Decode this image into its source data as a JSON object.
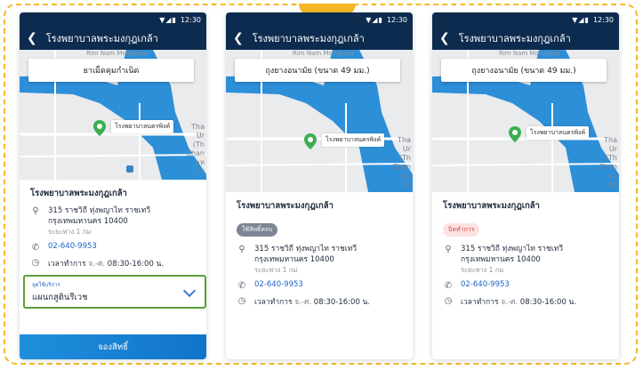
{
  "statusbar": {
    "time": "12:30",
    "icons": "▼◢▮"
  },
  "nav": {
    "title": "โรงพยาบาลพระมงกุฎเกล้า"
  },
  "map": {
    "street_label": "Rim Nam Mongkata",
    "poi_label": "โรงพยาบาลนครพิงค์",
    "side_text": [
      "Tha",
      "Ur",
      "(Th",
      "Chan",
      "มห",
      "ธร"
    ]
  },
  "phones": [
    {
      "callout": "ยาเม็ดคุมกำเนิด",
      "name": "โรงพยาบาลพระมงกุฎเกล้า",
      "address_line1": "315 ราชวิถี ทุ่งพญาไท ราชเทวี",
      "address_line2": "กรุงเทพมหานคร 10400",
      "distance": "ระยะทาง 1 กม",
      "phone": "02-640-9953",
      "hours_label": "เวลาทำการ",
      "hours_days": "จ.-ศ.",
      "hours_time": "08:30-16:00 น.",
      "select_label": "จุดใช้บริการ",
      "select_value": "แผนกสูตินรีเวช",
      "cta": "จองสิทธิ์"
    },
    {
      "callout": "ถุงยางอนามัย (ขนาด 49 มม.)",
      "name": "โรงพยาบาลพระมงกุฎเกล้า",
      "badge": "ใช้สิทธิ์ครบ",
      "address_line1": "315 ราชวิถี ทุ่งพญาไท ราชเทวี",
      "address_line2": "กรุงเทพมหานคร 10400",
      "distance": "ระยะทาง 1 กม",
      "phone": "02-640-9953",
      "hours_label": "เวลาทำการ",
      "hours_days": "จ.-ศ.",
      "hours_time": "08:30-16:00 น."
    },
    {
      "callout": "ถุงยางอนามัย (ขนาด 49 มม.)",
      "name": "โรงพยาบาลพระมงกุฎเกล้า",
      "badge": "ปิดทำการ",
      "address_line1": "315 ราชวิถี ทุ่งพญาไท ราชเทวี",
      "address_line2": "กรุงเทพมหานคร 10400",
      "distance": "ระยะทาง 1 กม",
      "phone": "02-640-9953",
      "hours_label": "เวลาทำการ",
      "hours_days": "จ.-ศ.",
      "hours_time": "08:30-16:00 น."
    }
  ],
  "colors": {
    "navbar": "#0d2b4f",
    "accent": "#1b64c4",
    "frame": "#f5b727",
    "pin": "#3cae4f",
    "water": "#2d8fd8",
    "select_border": "#5da03a"
  }
}
